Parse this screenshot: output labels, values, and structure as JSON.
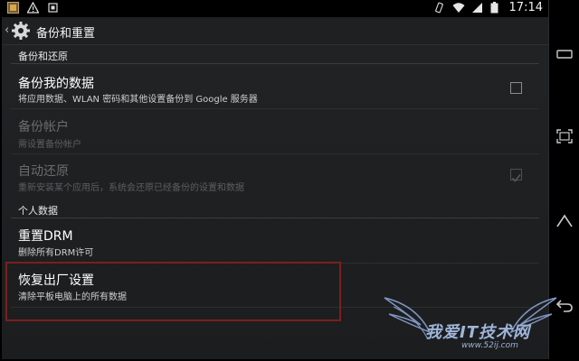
{
  "status_bar": {
    "time": "17:14"
  },
  "action_bar": {
    "title": "备份和重置"
  },
  "sections": [
    {
      "header": "备份和还原"
    },
    {
      "header": "个人数据"
    }
  ],
  "items": [
    {
      "title": "备份我的数据",
      "subtitle": "将应用数据、WLAN 密码和其他设置备份到 Google 服务器",
      "checked": false,
      "enabled": true
    },
    {
      "title": "备份帐户",
      "subtitle": "需设置备份帐户",
      "enabled": false
    },
    {
      "title": "自动还原",
      "subtitle": "重新安装某个应用后，系统会还原已经备份的设置和数据",
      "checked": true,
      "enabled": false
    },
    {
      "title": "重置DRM",
      "subtitle": "删除所有DRM许可",
      "enabled": true
    },
    {
      "title": "恢复出厂设置",
      "subtitle": "清除平板电脑上的所有数据",
      "enabled": true
    }
  ],
  "watermark": {
    "text": "我爱IT技术网",
    "url": "www.52ij.com"
  },
  "icons": {
    "status_left": [
      "gallery-icon",
      "warning-icon",
      "notification-icon"
    ],
    "status_right": [
      "vibrate-icon",
      "wifi-icon",
      "signal-icon",
      "battery-icon"
    ],
    "nav": [
      "recents-icon",
      "home-icon",
      "back-icon"
    ]
  },
  "colors": {
    "highlight": "#7b1f1f",
    "background": "#1e2022"
  }
}
